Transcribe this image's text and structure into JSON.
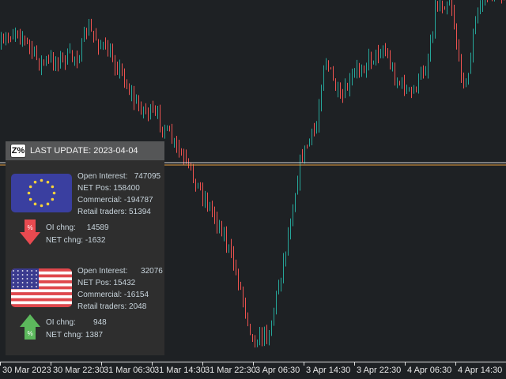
{
  "panel": {
    "logo": "Z%",
    "title": "LAST UPDATE: 2023-04-04",
    "eur": {
      "open_interest_label": "Open Interest:",
      "open_interest": "747095",
      "net_pos": "NET Pos: 158400",
      "commercial": "Commercial: -194787",
      "retail": "Retail traders: 51394",
      "oi_chng_label": "OI chng:",
      "oi_chng": "14589",
      "net_chng": "NET chng: -1632",
      "direction": "down"
    },
    "usd": {
      "open_interest_label": "Open Interest:",
      "open_interest": "32076",
      "net_pos": "NET Pos: 15432",
      "commercial": "Commercial: -16154",
      "retail": "Retail traders: 2048",
      "oi_chng_label": "OI chng:",
      "oi_chng": "948",
      "net_chng": "NET chng: 1387",
      "direction": "up"
    }
  },
  "time_axis": [
    "30 Mar 2023",
    "30 Mar 22:30",
    "31 Mar 06:30",
    "31 Mar 14:30",
    "31 Mar 22:30",
    "3 Apr 06:30",
    "3 Apr 14:30",
    "3 Apr 22:30",
    "4 Apr 06:30",
    "4 Apr 14:30"
  ],
  "colors": {
    "bull": "#26a69a",
    "bear": "#ef5350",
    "bid_line": "#e0e0e0",
    "ask_line": "#e8a040"
  }
}
